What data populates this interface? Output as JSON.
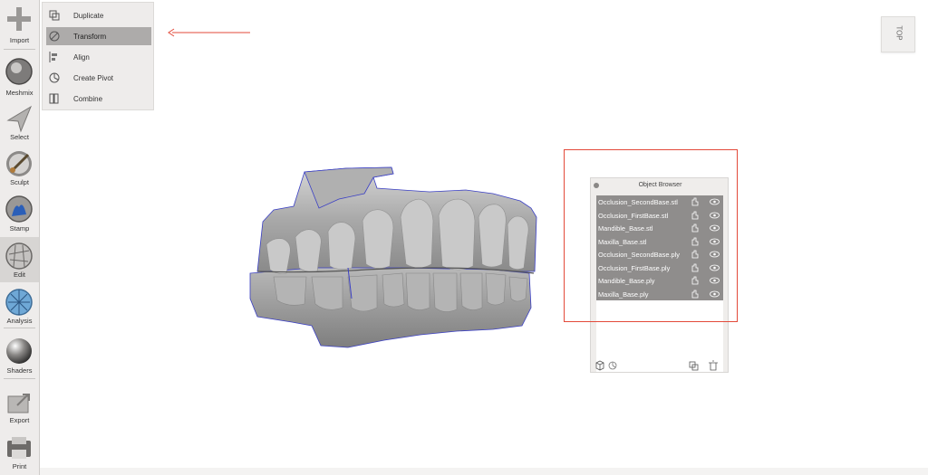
{
  "toolbar": {
    "items": [
      {
        "label": "Import",
        "icon": "plus-icon"
      },
      {
        "label": "Meshmix",
        "icon": "meshmix-icon"
      },
      {
        "label": "Select",
        "icon": "select-arrow-icon"
      },
      {
        "label": "Sculpt",
        "icon": "brush-icon"
      },
      {
        "label": "Stamp",
        "icon": "stamp-icon"
      },
      {
        "label": "Edit",
        "icon": "edit-icon"
      },
      {
        "label": "Analysis",
        "icon": "analysis-icon"
      },
      {
        "label": "Shaders",
        "icon": "shader-sphere-icon"
      },
      {
        "label": "Export",
        "icon": "export-icon"
      },
      {
        "label": "Print",
        "icon": "printer-icon"
      }
    ],
    "active": "Edit"
  },
  "edit_menu": {
    "items": [
      {
        "label": "Duplicate",
        "icon": "duplicate-icon"
      },
      {
        "label": "Transform",
        "icon": "transform-icon"
      },
      {
        "label": "Align",
        "icon": "align-icon"
      },
      {
        "label": "Create Pivot",
        "icon": "pivot-icon"
      },
      {
        "label": "Combine",
        "icon": "combine-icon"
      }
    ],
    "selected": "Transform"
  },
  "view_cube": {
    "label": "TOP"
  },
  "object_browser": {
    "title": "Object Browser",
    "objects": [
      "Occlusion_SecondBase.stl",
      "Occlusion_FirstBase.stl",
      "Mandible_Base.stl",
      "Maxilla_Base.stl",
      "Occlusion_SecondBase.ply",
      "Occlusion_FirstBase.ply",
      "Mandible_Base.ply",
      "Maxilla_Base.ply"
    ]
  },
  "colors": {
    "annotation": "#e34a3a",
    "row_selected": "#8f8d8c",
    "toolbar_bg": "#eeeceb",
    "mesh_outline": "#3a3fc4"
  }
}
